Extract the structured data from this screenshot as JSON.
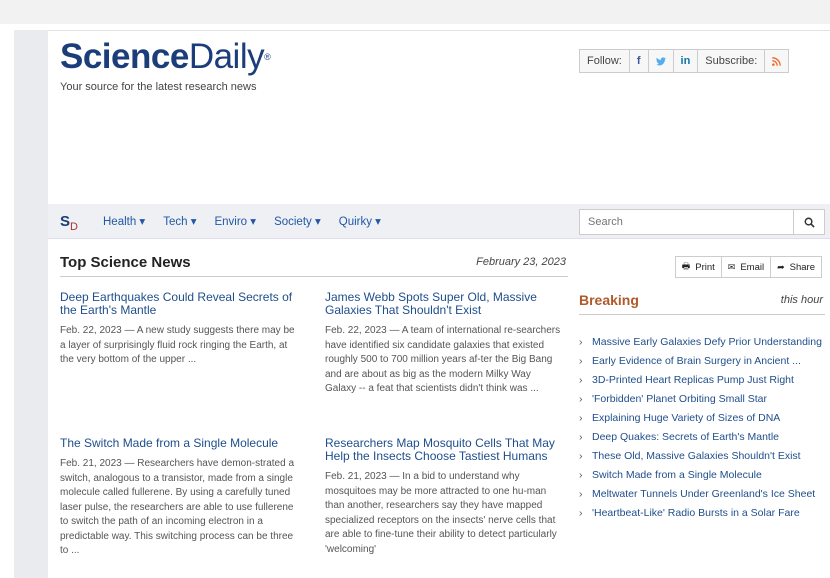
{
  "header": {
    "logo_bold": "Science",
    "logo_regular": "Daily",
    "logo_mark": "®",
    "tagline": "Your source for the latest research news",
    "follow_label": "Follow:",
    "social": {
      "facebook": "f",
      "twitter": "🐦",
      "linkedin": "in"
    },
    "subscribe_label": "Subscribe:",
    "rss_icon": "rss-icon"
  },
  "nav": {
    "mark": "S",
    "mark_sub": "D",
    "items": [
      {
        "label": "Health ▾"
      },
      {
        "label": "Tech ▾"
      },
      {
        "label": "Enviro ▾"
      },
      {
        "label": "Society ▾"
      },
      {
        "label": "Quirky ▾"
      }
    ],
    "search_placeholder": "Search",
    "search_icon": "🔍"
  },
  "main": {
    "title": "Top Science News",
    "date": "February 23, 2023",
    "stories": [
      {
        "headline": "Deep Earthquakes Could Reveal Secrets of the Earth's Mantle",
        "summary": "Feb. 22, 2023 — A new study suggests there may be a layer of surprisingly fluid rock ringing the Earth, at the very bottom of the upper ..."
      },
      {
        "headline": "James Webb Spots Super Old, Massive Galaxies That Shouldn't Exist",
        "summary": "Feb. 22, 2023 — A team of international re-searchers have identified six candidate galaxies that existed roughly 500 to 700 million years af-ter the Big Bang and are about as big as the modern Milky Way Galaxy -- a feat that scientists didn't think was ..."
      },
      {
        "headline": "The Switch Made from a Single Molecule",
        "summary": "Feb. 21, 2023 — Researchers have demon-strated a switch, analogous to a transistor, made from a single molecule called fullerene. By using a carefully tuned laser pulse, the researchers are able to use fullerene to switch the path of an incoming electron in a predictable way. This switching process can be three to ..."
      },
      {
        "headline": "Researchers Map Mosquito Cells That May Help the Insects Choose Tastiest Humans",
        "summary": "Feb. 21, 2023 — In a bid to understand why mosquitoes may be more attracted to one hu-man than another, researchers say they have mapped specialized receptors on the insects' nerve cells that are able to fine-tune their ability to detect particularly 'welcoming'"
      }
    ]
  },
  "sidebar": {
    "share_buttons": [
      {
        "icon": "🖶",
        "label": "Print"
      },
      {
        "icon": "✉",
        "label": "Email"
      },
      {
        "icon": "➦",
        "label": "Share"
      }
    ],
    "breaking_title": "Breaking",
    "breaking_period": "this hour",
    "breaking_items": [
      "Massive Early Galaxies Defy Prior Understanding",
      "Early Evidence of Brain Surgery in Ancient ...",
      "3D-Printed Heart Replicas Pump Just Right",
      "'Forbidden' Planet Orbiting Small Star",
      "Explaining Huge Variety of Sizes of DNA",
      "Deep Quakes: Secrets of Earth's Mantle",
      "These Old, Massive Galaxies Shouldn't Exist",
      "Switch Made from a Single Molecule",
      "Meltwater Tunnels Under Greenland's Ice Sheet",
      "'Heartbeat-Like' Radio Bursts in a Solar Fare"
    ]
  }
}
